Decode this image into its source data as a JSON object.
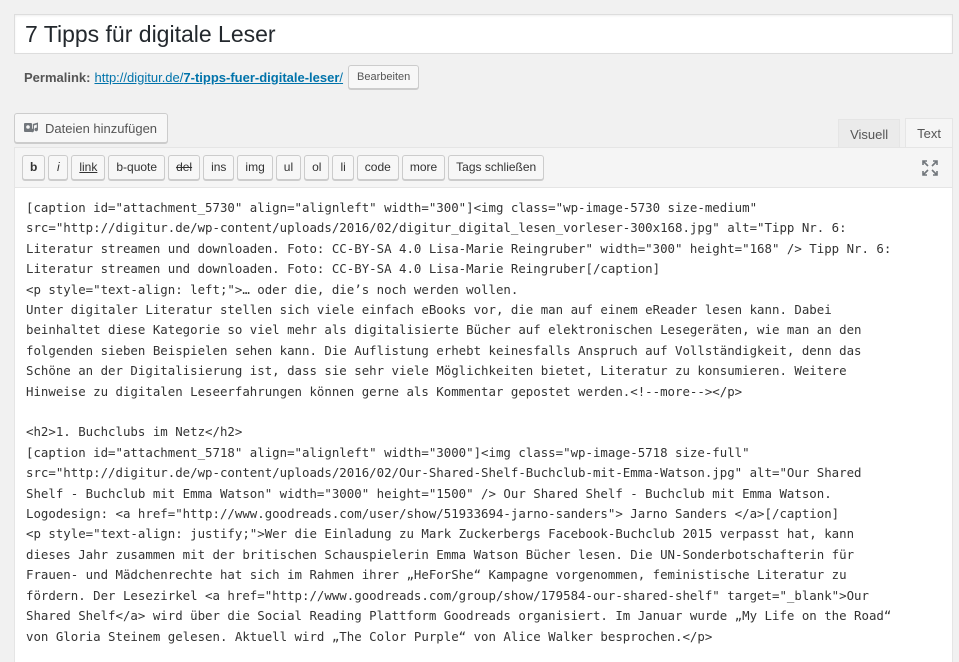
{
  "title": {
    "value": "7 Tipps für digitale Leser"
  },
  "permalink": {
    "label": "Permalink:",
    "url_prefix": "http://digitur.de/",
    "slug": "7-tipps-fuer-digitale-leser",
    "url_suffix": "/",
    "edit_button": "Bearbeiten"
  },
  "media": {
    "add_button": "Dateien hinzufügen",
    "icon": "media-icon"
  },
  "tabs": {
    "visual": "Visuell",
    "text": "Text"
  },
  "toolbar": {
    "buttons": [
      "b",
      "i",
      "link",
      "b-quote",
      "del",
      "ins",
      "img",
      "ul",
      "ol",
      "li",
      "code",
      "more",
      "Tags schließen"
    ],
    "fullscreen_icon": "fullscreen-icon"
  },
  "content": {
    "lines": [
      "[caption id=\"attachment_5730\" align=\"alignleft\" width=\"300\"]<img class=\"wp-image-5730 size-medium\"",
      "src=\"http://digitur.de/wp-content/uploads/2016/02/digitur_digital_lesen_vorleser-300x168.jpg\" alt=\"Tipp Nr. 6:",
      "Literatur streamen und downloaden. Foto: CC-BY-SA 4.0 Lisa-Marie Reingruber\" width=\"300\" height=\"168\" /> Tipp Nr. 6:",
      "Literatur streamen und downloaden. Foto: CC-BY-SA 4.0 Lisa-Marie Reingruber[/caption]",
      "<p style=\"text-align: left;\">… oder die, die’s noch werden wollen.",
      "Unter digitaler Literatur stellen sich viele einfach eBooks vor, die man auf einem eReader lesen kann. Dabei",
      "beinhaltet diese Kategorie so viel mehr als digitalisierte Bücher auf elektronischen Lesegeräten, wie man an den",
      "folgenden sieben Beispielen sehen kann. Die Auflistung erhebt keinesfalls Anspruch auf Vollständigkeit, denn das",
      "Schöne an der Digitalisierung ist, dass sie sehr viele Möglichkeiten bietet, Literatur zu konsumieren. Weitere",
      "Hinweise zu digitalen Leseerfahrungen können gerne als Kommentar gepostet werden.<!--more--></p>",
      "",
      "<h2>1. Buchclubs im Netz</h2>",
      "[caption id=\"attachment_5718\" align=\"alignleft\" width=\"3000\"]<img class=\"wp-image-5718 size-full\"",
      "src=\"http://digitur.de/wp-content/uploads/2016/02/Our-Shared-Shelf-Buchclub-mit-Emma-Watson.jpg\" alt=\"Our Shared",
      "Shelf - Buchclub mit Emma Watson\" width=\"3000\" height=\"1500\" /> Our Shared Shelf - Buchclub mit Emma Watson.",
      "Logodesign: <a href=\"http://www.goodreads.com/user/show/51933694-jarno-sanders\"> Jarno Sanders </a>[/caption]",
      "<p style=\"text-align: justify;\">Wer die Einladung zu Mark Zuckerbergs Facebook-Buchclub 2015 verpasst hat, kann",
      "dieses Jahr zusammen mit der britischen Schauspielerin Emma Watson Bücher lesen. Die UN-Sonderbotschafterin für",
      "Frauen- und Mädchenrechte hat sich im Rahmen ihrer „HeForShe“ Kampagne vorgenommen, feministische Literatur zu",
      "fördern. Der Lesezirkel <a href=\"http://www.goodreads.com/group/show/179584-our-shared-shelf\" target=\"_blank\">Our",
      "Shared Shelf</a> wird über die Social Reading Plattform Goodreads organisiert. Im Januar wurde „My Life on the Road“",
      "von Gloria Steinem gelesen. Aktuell wird „The Color Purple“ von Alice Walker besprochen.</p>"
    ]
  }
}
